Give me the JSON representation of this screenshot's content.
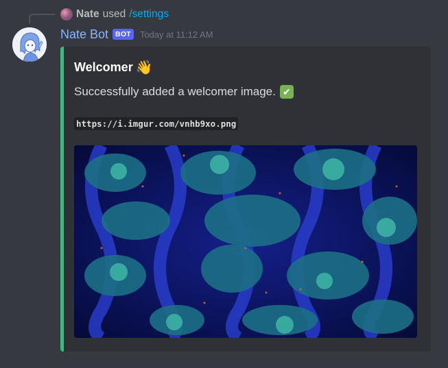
{
  "reply": {
    "user": "Nate",
    "used": "used",
    "command": "/settings"
  },
  "message": {
    "username": "Nate Bot",
    "bot_tag": "BOT",
    "timestamp": "Today at 11:12 AM"
  },
  "embed": {
    "accent_color": "#43b581",
    "title": "Welcomer",
    "title_emoji": "👋",
    "description": "Successfully added a welcomer image.",
    "description_emoji": "✔",
    "code": "https://i.imgur.com/vnhb9xo.png",
    "image_icon": "floral-pattern-image"
  },
  "colors": {
    "background": "#36393f",
    "embed_bg": "#2f3136",
    "username": "#8ab4ff",
    "command": "#00aff4",
    "bot_tag": "#5865f2"
  }
}
